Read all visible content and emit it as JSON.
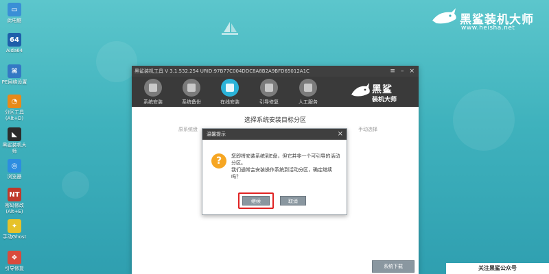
{
  "desktop_icons": [
    {
      "label": "此电脑",
      "icon": "computer-icon",
      "glyph": "▭",
      "color": "#3a8fd6"
    },
    {
      "label": "Aida64",
      "icon": "aida64-icon",
      "glyph": "64",
      "color": "#1e5faa"
    },
    {
      "label": "PE网络设置",
      "icon": "network-icon",
      "glyph": "⌘",
      "color": "#3478c4"
    },
    {
      "label": "分区工具",
      "label2": "(Alt+D)",
      "icon": "partition-tool-icon",
      "glyph": "◔",
      "color": "#e88a1a"
    },
    {
      "label": "黑鲨装机大",
      "label2": "师",
      "icon": "heisha-icon",
      "glyph": "◣",
      "color": "#2c2c2c"
    },
    {
      "label": "浏览器",
      "icon": "browser-icon",
      "glyph": "◎",
      "color": "#2d8de0"
    },
    {
      "label": "密码修改",
      "label2": "(Alt+E)",
      "icon": "password-icon",
      "glyph": "NT",
      "color": "#c0392b"
    },
    {
      "label": "手动Ghost",
      "icon": "ghost-icon",
      "glyph": "✦",
      "color": "#e6c229"
    },
    {
      "label": "引导修复",
      "icon": "boot-repair-icon",
      "glyph": "❖",
      "color": "#d94b3d"
    }
  ],
  "brand": {
    "name": "黑鲨装机大师",
    "url": "www.heisha.net"
  },
  "window": {
    "title": "黑鲨装机工具 V 3.1.532.254 URID:97B77C004DDC8A8B2A9BFD65012A1C",
    "minimize": "–",
    "menu": "≡",
    "close": "×",
    "tools": [
      {
        "label": "系统安装",
        "active": false
      },
      {
        "label": "系统备份",
        "active": false
      },
      {
        "label": "在线安装",
        "active": true
      },
      {
        "label": "引导修复",
        "active": false
      },
      {
        "label": "人工服务",
        "active": false
      }
    ],
    "logo": {
      "line1": "黑鲨",
      "line2": "装机大师"
    },
    "heading": "选择系统安装目标分区",
    "subline": "原系统盘",
    "subline_right": "手动选择",
    "download_button": "系统下载"
  },
  "dialog": {
    "title": "温馨提示",
    "close": "×",
    "icon_glyph": "?",
    "message_1": "您即将安装系统到E盘，但它并非一个可引导的活动分区。",
    "message_2": "我们通常会安装操作系统到活动分区，确定继续吗？",
    "ok_label": "继续",
    "cancel_label": "取消"
  },
  "follow_bar": "关注黑鲨公众号"
}
